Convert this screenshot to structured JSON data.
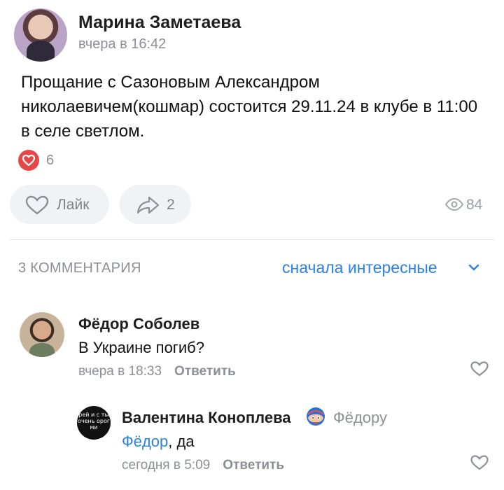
{
  "post": {
    "author": "Марина Заметаева",
    "time": "вчера в 16:42",
    "text": "Прощание с Сазоновым Александром николаевичем(кошмар) состоится 29.11.24 в клубе в 11:00 в селе светлом.",
    "reaction_count": "6",
    "like_label": "Лайк",
    "share_count": "2",
    "views_count": "84"
  },
  "comments_header": {
    "count_label": "3 КОММЕНТАРИЯ",
    "sort_label": "сначала интересные"
  },
  "comments": [
    {
      "author": "Фёдор Соболев",
      "text": "В Украине погиб?",
      "time": "вчера в 18:33",
      "reply_label": "Ответить"
    },
    {
      "author": "Валентина Коноплева",
      "reply_to": "Фёдору",
      "mention": "Фёдор",
      "text": ", да",
      "time": "сегодня в 5:09",
      "reply_label": "Ответить",
      "avatar_text": "рей и с ты очень орог ми"
    }
  ],
  "colors": {
    "accent": "#2d81e0",
    "heart": "#e64646",
    "secondary_text": "#8c8f94"
  }
}
